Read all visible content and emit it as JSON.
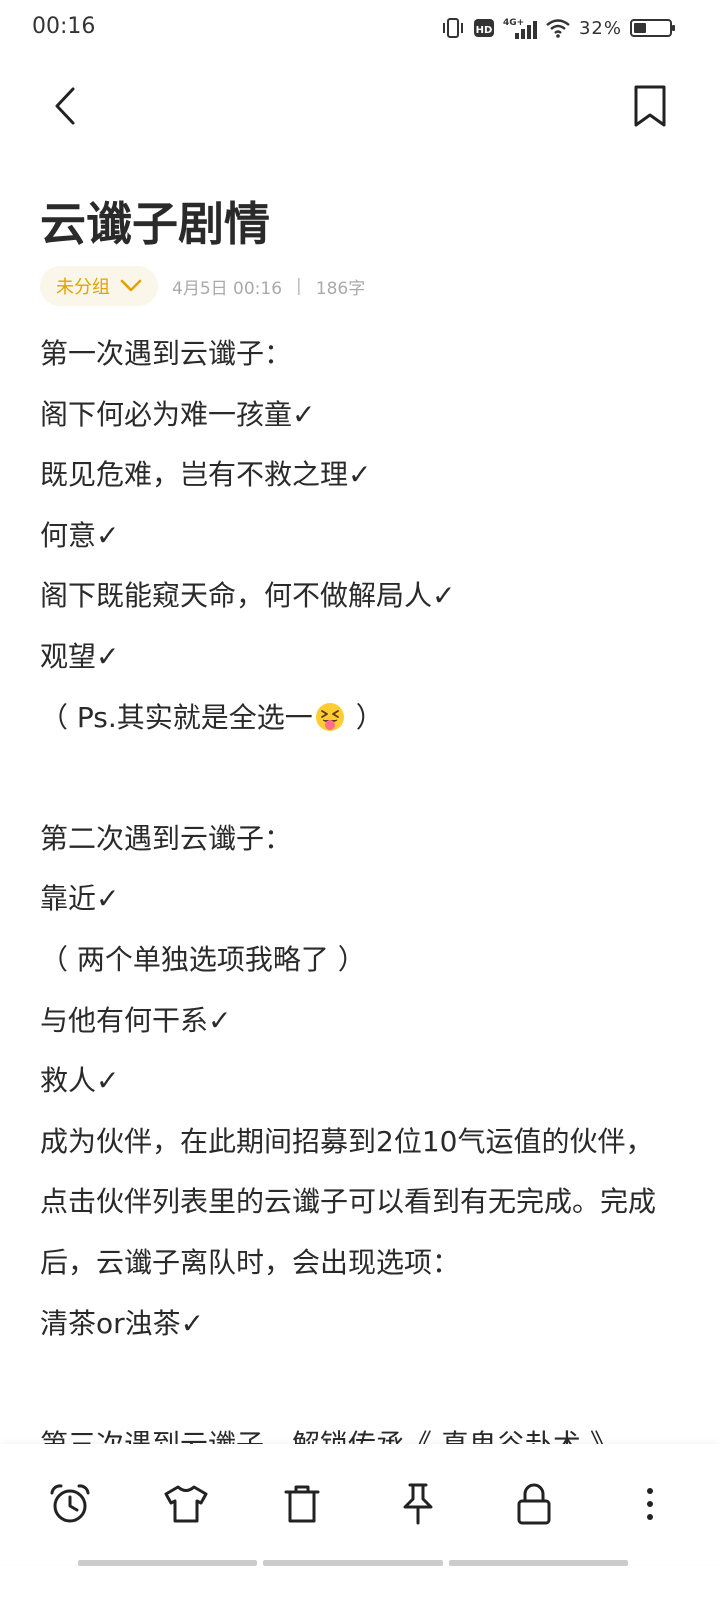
{
  "status_bar": {
    "time": "00:16",
    "network_label": "4G+",
    "hd_label": "HD",
    "battery": "32%"
  },
  "header": {
    "back_icon": "chevron-left-icon",
    "bookmark_icon": "bookmark-icon"
  },
  "note": {
    "title": "云谶子剧情",
    "group": "未分组",
    "date": "4月5日 00:16",
    "separator": "|",
    "char_count": "186字",
    "lines": [
      "第一次遇到云谶子：",
      "阁下何必为难一孩童✓",
      "既见危难，岂有不救之理✓",
      "何意✓",
      "阁下既能窥天命，何不做解局人✓",
      "观望✓",
      "（ Ps.其实就是全选一",
      "",
      "第二次遇到云谶子：",
      "靠近✓",
      "（ 两个单独选项我略了 ）",
      "与他有何干系✓",
      "救人✓",
      "成为伙伴，在此期间招募到2位10气运值的伙伴，点击伙伴列表里的云谶子可以看到有无完成。完成后，云谶子离队时，会出现选项：",
      "清茶or浊茶✓",
      "",
      "第三次遇到云谶子，解锁传承《 真鬼谷卦术 》"
    ],
    "ps_suffix": " ）"
  },
  "toolbar": {
    "icons": [
      "alarm-clock-icon",
      "shirt-icon",
      "trash-icon",
      "pin-icon",
      "lock-icon",
      "more-vertical-icon"
    ]
  },
  "colors": {
    "accent": "#e0a400",
    "chip_bg": "#fbf6ea",
    "text": "#2a2a2a",
    "meta": "#aaaaaa"
  }
}
